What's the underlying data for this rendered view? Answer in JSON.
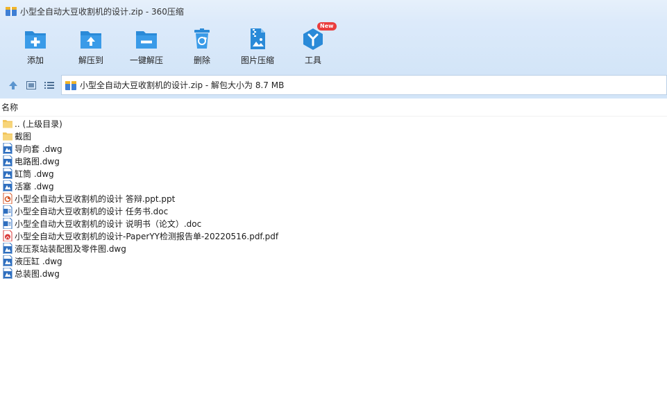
{
  "window": {
    "title": "小型全自动大豆收割机的设计.zip - 360压缩",
    "app_icon": "archive-app-icon"
  },
  "toolbar": {
    "buttons": [
      {
        "id": "add",
        "label": "添加",
        "icon": "folder-plus-icon"
      },
      {
        "id": "extract-to",
        "label": "解压到",
        "icon": "folder-upload-icon"
      },
      {
        "id": "one-click-extract",
        "label": "一键解压",
        "icon": "folder-minus-icon"
      },
      {
        "id": "delete",
        "label": "删除",
        "icon": "recycle-bin-icon"
      },
      {
        "id": "image-compress",
        "label": "图片压缩",
        "icon": "image-zip-icon"
      },
      {
        "id": "tools",
        "label": "工具",
        "icon": "tools-hex-icon",
        "badge": "New"
      }
    ],
    "accent": "#2a8ad8"
  },
  "address": {
    "path": "小型全自动大豆收割机的设计.zip - 解包大小为 8.7 MB",
    "nav_icons": [
      "up-arrow-icon",
      "thumbnail-view-icon",
      "list-view-icon"
    ]
  },
  "file_list": {
    "column_name": "名称",
    "items": [
      {
        "name": ".. (上级目录)",
        "type": "folder"
      },
      {
        "name": "截图",
        "type": "folder"
      },
      {
        "name": "导向套 .dwg",
        "type": "dwg"
      },
      {
        "name": "电路图.dwg",
        "type": "dwg"
      },
      {
        "name": "缸筒 .dwg",
        "type": "dwg"
      },
      {
        "name": "活塞 .dwg",
        "type": "dwg"
      },
      {
        "name": "小型全自动大豆收割机的设计 答辩.ppt.ppt",
        "type": "ppt"
      },
      {
        "name": "小型全自动大豆收割机的设计 任务书.doc",
        "type": "doc"
      },
      {
        "name": "小型全自动大豆收割机的设计 说明书（论文）.doc",
        "type": "doc"
      },
      {
        "name": "小型全自动大豆收割机的设计-PaperYY检测报告单-20220516.pdf.pdf",
        "type": "pdf"
      },
      {
        "name": "液压泵站装配图及零件图.dwg",
        "type": "dwg"
      },
      {
        "name": "液压缸 .dwg",
        "type": "dwg"
      },
      {
        "name": "总装图.dwg",
        "type": "dwg"
      }
    ]
  }
}
